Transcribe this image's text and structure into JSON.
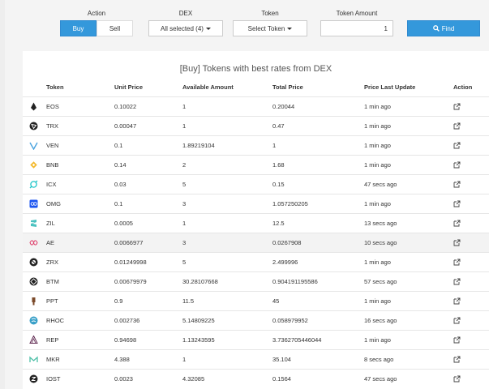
{
  "filters": {
    "action_label": "Action",
    "buy_label": "Buy",
    "sell_label": "Sell",
    "dex_label": "DEX",
    "dex_value": "All selected (4)",
    "token_label": "Token",
    "token_value": "Select Token",
    "amount_label": "Token Amount",
    "amount_value": "1",
    "find_label": "Find"
  },
  "panel": {
    "title": "[Buy] Tokens with best rates from DEX"
  },
  "table": {
    "headers": {
      "token": "Token",
      "unit_price": "Unit Price",
      "available": "Available Amount",
      "total": "Total Price",
      "last_update": "Price Last Update",
      "action": "Action"
    },
    "rows": [
      {
        "token": "EOS",
        "icon": "eos-icon",
        "unit_price": "0.10022",
        "available": "1",
        "total": "0.20044",
        "last_update": "1 min ago"
      },
      {
        "token": "TRX",
        "icon": "trx-icon",
        "unit_price": "0.00047",
        "available": "1",
        "total": "0.47",
        "last_update": "1 min ago"
      },
      {
        "token": "VEN",
        "icon": "ven-icon",
        "unit_price": "0.1",
        "available": "1.89219104",
        "total": "1",
        "last_update": "1 min ago"
      },
      {
        "token": "BNB",
        "icon": "bnb-icon",
        "unit_price": "0.14",
        "available": "2",
        "total": "1.68",
        "last_update": "1 min ago"
      },
      {
        "token": "ICX",
        "icon": "icx-icon",
        "unit_price": "0.03",
        "available": "5",
        "total": "0.15",
        "last_update": "47 secs ago"
      },
      {
        "token": "OMG",
        "icon": "omg-icon",
        "unit_price": "0.1",
        "available": "3",
        "total": "1.057250205",
        "last_update": "1 min ago"
      },
      {
        "token": "ZIL",
        "icon": "zil-icon",
        "unit_price": "0.0005",
        "available": "1",
        "total": "12.5",
        "last_update": "13 secs ago"
      },
      {
        "token": "AE",
        "icon": "ae-icon",
        "unit_price": "0.0066977",
        "available": "3",
        "total": "0.0267908",
        "last_update": "10 secs ago"
      },
      {
        "token": "ZRX",
        "icon": "zrx-icon",
        "unit_price": "0.01249998",
        "available": "5",
        "total": "2.499996",
        "last_update": "1 min ago"
      },
      {
        "token": "BTM",
        "icon": "btm-icon",
        "unit_price": "0.00679979",
        "available": "30.28107668",
        "total": "0.904191195586",
        "last_update": "57 secs ago"
      },
      {
        "token": "PPT",
        "icon": "ppt-icon",
        "unit_price": "0.9",
        "available": "11.5",
        "total": "45",
        "last_update": "1 min ago"
      },
      {
        "token": "RHOC",
        "icon": "rhoc-icon",
        "unit_price": "0.002736",
        "available": "5.14809225",
        "total": "0.058979952",
        "last_update": "16 secs ago"
      },
      {
        "token": "REP",
        "icon": "rep-icon",
        "unit_price": "0.94698",
        "available": "1.13243595",
        "total": "3.7362705446044",
        "last_update": "1 min ago"
      },
      {
        "token": "MKR",
        "icon": "mkr-icon",
        "unit_price": "4.388",
        "available": "1",
        "total": "35.104",
        "last_update": "8 secs ago"
      },
      {
        "token": "IOST",
        "icon": "iost-icon",
        "unit_price": "0.0023",
        "available": "4.32085",
        "total": "0.1564",
        "last_update": "47 secs ago"
      }
    ]
  },
  "colors": {
    "accent": "#3498db",
    "highlight_row": "#f3f3f3"
  }
}
